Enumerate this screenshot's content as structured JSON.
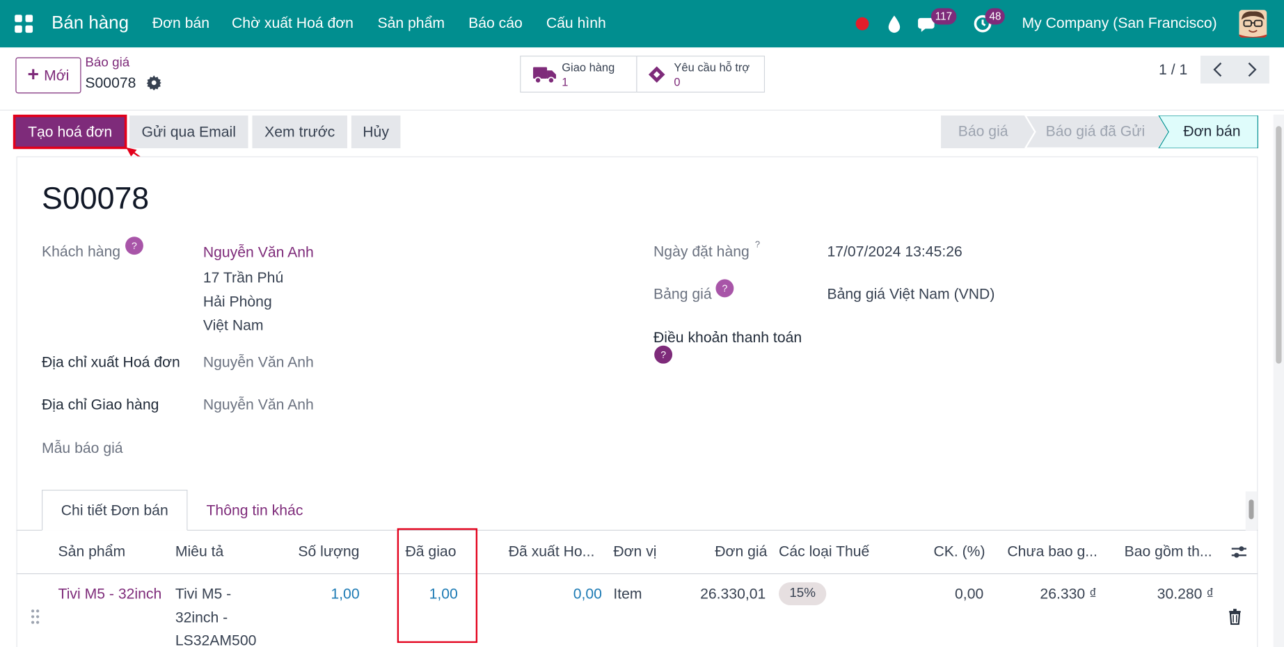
{
  "navbar": {
    "app_name": "Bán hàng",
    "menu": [
      "Đơn bán",
      "Chờ xuất Hoá đơn",
      "Sản phẩm",
      "Báo cáo",
      "Cấu hình"
    ],
    "messages_count": "117",
    "activities_count": "48",
    "company": "My Company (San Francisco)",
    "icons": [
      "apps-icon",
      "record-icon",
      "droplet-icon",
      "chat-icon",
      "clock-icon",
      "avatar"
    ]
  },
  "control": {
    "new_label": "Mới",
    "breadcrumb_parent": "Báo giá",
    "breadcrumb_current": "S00078",
    "delivery_label": "Giao hàng",
    "delivery_count": "1",
    "support_label": "Yêu cầu hỗ trợ",
    "support_count": "0",
    "pager": "1 / 1"
  },
  "actions": {
    "create_invoice": "Tạo hoá đơn",
    "send_email": "Gửi qua Email",
    "preview": "Xem trước",
    "cancel": "Hủy"
  },
  "status_bar": {
    "stages": [
      "Báo giá",
      "Báo giá đã Gửi",
      "Đơn bán"
    ],
    "current": "Đơn bán"
  },
  "form": {
    "title": "S00078",
    "customer_label": "Khách hàng",
    "customer_name": "Nguyễn Văn Anh",
    "customer_address": [
      "17 Trần Phú",
      "Hải Phòng",
      "Việt Nam"
    ],
    "invoice_address_label": "Địa chỉ xuất Hoá đơn",
    "invoice_address": "Nguyễn Văn Anh",
    "delivery_address_label": "Địa chỉ Giao hàng",
    "delivery_address": "Nguyễn Văn Anh",
    "quote_template_label": "Mẫu báo giá",
    "order_date_label": "Ngày đặt hàng",
    "order_date_sup": "?",
    "order_date": "17/07/2024 13:45:26",
    "pricelist_label": "Bảng giá",
    "pricelist": "Bảng giá Việt Nam (VND)",
    "payment_terms_label": "Điều khoản thanh toán",
    "help_mark": "?"
  },
  "tabs": [
    "Chi tiết Đơn bán",
    "Thông tin khác"
  ],
  "table": {
    "headers": [
      "Sản phẩm",
      "Miêu tả",
      "Số lượng",
      "Đã giao",
      "Đã xuất Ho...",
      "Đơn vị",
      "Đơn giá",
      "Các loại Thuế",
      "CK. (%)",
      "Chưa bao g...",
      "Bao gồm th..."
    ],
    "rows": [
      {
        "product": "Tivi M5 - 32inch",
        "description": [
          "Tivi M5 -",
          "32inch -",
          "LS32AM500"
        ],
        "quantity": "1,00",
        "delivered": "1,00",
        "invoiced": "0,00",
        "uom": "Item",
        "unit_price": "26.330,01",
        "taxes": "15%",
        "discount": "0,00",
        "subtotal": "26.330 ₫",
        "total": "30.280 ₫"
      }
    ]
  }
}
